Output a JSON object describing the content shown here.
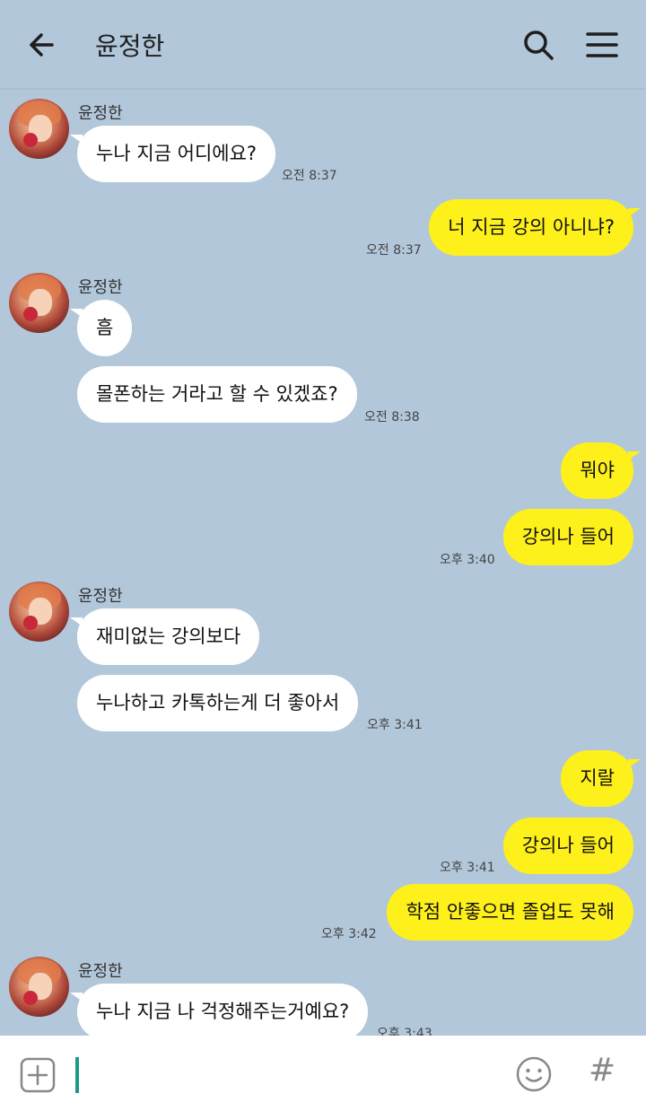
{
  "header": {
    "title": "윤정한"
  },
  "messages": [
    {
      "type": "in",
      "sender": "윤정한",
      "text": "누나 지금 어디에요?",
      "time": "오전 8:37"
    },
    {
      "type": "out",
      "text": "너 지금 강의 아니냐?",
      "time": "오전 8:37"
    },
    {
      "type": "in",
      "sender": "윤정한",
      "text": "흠"
    },
    {
      "type": "in",
      "text": "몰폰하는 거라고 할 수 있겠죠?",
      "time": "오전 8:38"
    },
    {
      "type": "out",
      "text": "뭐야"
    },
    {
      "type": "out",
      "text": "강의나 들어",
      "time": "오후 3:40"
    },
    {
      "type": "in",
      "sender": "윤정한",
      "text": "재미없는 강의보다"
    },
    {
      "type": "in",
      "text": "누나하고 카톡하는게 더 좋아서",
      "time": "오후 3:41"
    },
    {
      "type": "out",
      "text": "지랄"
    },
    {
      "type": "out",
      "text": "강의나 들어",
      "time": "오후 3:41"
    },
    {
      "type": "out",
      "text": "학점 안좋으면 졸업도 못해",
      "time": "오후 3:42"
    },
    {
      "type": "in",
      "sender": "윤정한",
      "text": "누나 지금 나 걱정해주는거예요?",
      "time": "오후 3:43"
    }
  ],
  "composer": {
    "hash_label": "#"
  }
}
